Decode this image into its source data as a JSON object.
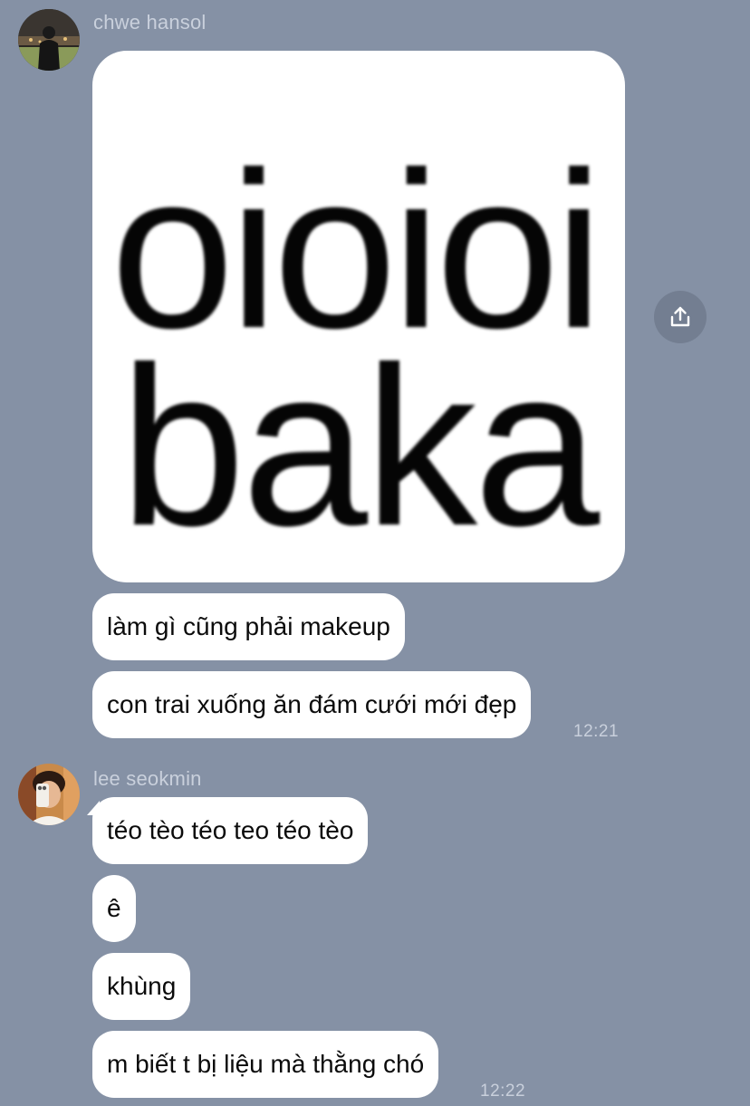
{
  "messages": [
    {
      "sender": "chwe hansol",
      "sticker": {
        "line1": "oioioi",
        "line2": "baka"
      },
      "bubbles": [
        "làm gì cũng phải makeup",
        "con trai xuống ăn đám cưới mới đẹp"
      ],
      "time": "12:21"
    },
    {
      "sender": "lee seokmin",
      "bubbles": [
        "téo tèo téo teo téo tèo",
        "ê",
        "khùng",
        "m biết t bị liệu mà thằng chó"
      ],
      "time": "12:22"
    }
  ],
  "colors": {
    "background": "#8591a5",
    "bubble": "#ffffff",
    "meta_text": "#c9d0dc"
  },
  "icons": {
    "share": "share-upload-icon"
  }
}
